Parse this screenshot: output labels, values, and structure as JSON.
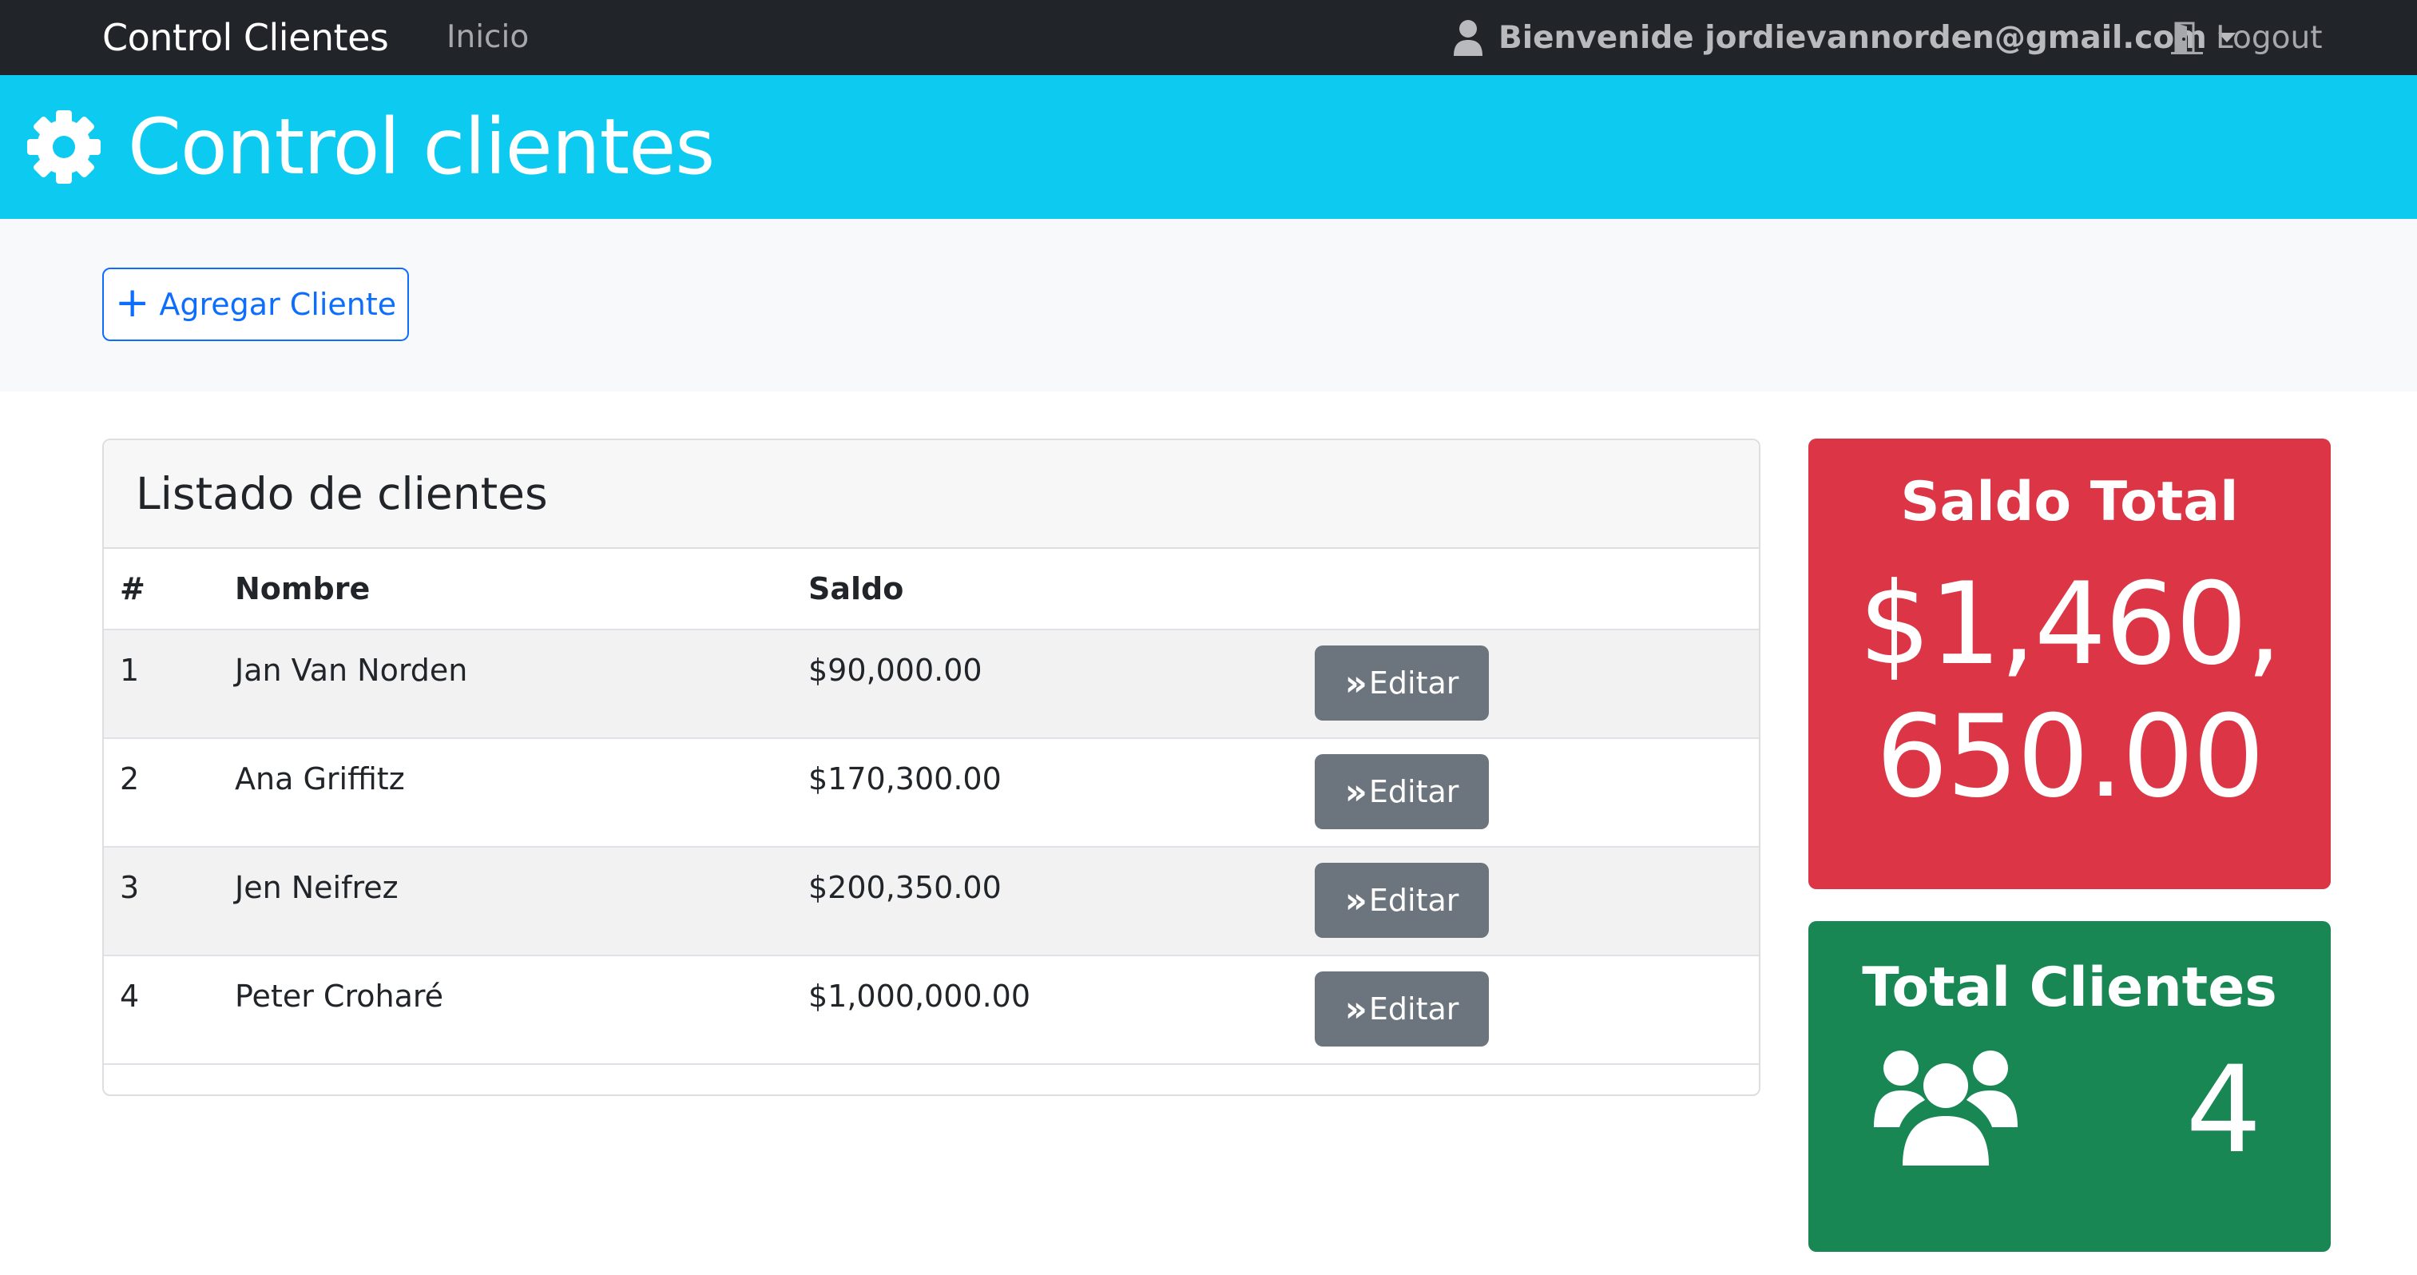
{
  "navbar": {
    "brand": "Control Clientes",
    "home_link": "Inicio",
    "user_label": "Bienvenide jordievannorden@gmail.com",
    "logout_label": "Logout"
  },
  "header": {
    "title": "Control clientes",
    "icon": "gear-icon"
  },
  "actions": {
    "add_label": "Agregar Cliente"
  },
  "clients": {
    "title": "Listado de clientes",
    "columns": [
      "#",
      "Nombre",
      "Saldo"
    ],
    "rows": [
      {
        "num": "1",
        "name": "Jan Van Norden",
        "saldo": "$90,000.00",
        "action": "Editar"
      },
      {
        "num": "2",
        "name": "Ana Griffitz",
        "saldo": "$170,300.00",
        "action": "Editar"
      },
      {
        "num": "3",
        "name": "Jen Neifrez",
        "saldo": "$200,350.00",
        "action": "Editar"
      },
      {
        "num": "4",
        "name": "Peter Croharé",
        "saldo": "$1,000,000.00",
        "action": "Editar"
      }
    ]
  },
  "stats": {
    "saldo_total": {
      "title": "Saldo Total",
      "value": "$1,460,650.00"
    },
    "total_clientes": {
      "title": "Total Clientes",
      "value": "4",
      "icon": "users-icon"
    }
  },
  "colors": {
    "navbar": "#212529",
    "header": "#0dcaf0",
    "primary": "#0d6efd",
    "secondary": "#6c757d",
    "danger": "#dc3545",
    "success": "#198754"
  }
}
